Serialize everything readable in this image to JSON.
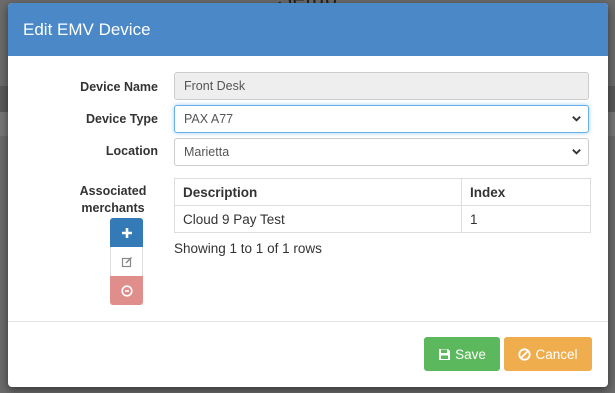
{
  "backdrop": {
    "title": "Setub"
  },
  "modal": {
    "title": "Edit EMV Device",
    "fields": {
      "device_name": {
        "label": "Device Name",
        "value": "Front Desk"
      },
      "device_type": {
        "label": "Device Type",
        "value": "PAX A77"
      },
      "location": {
        "label": "Location",
        "value": "Marietta"
      }
    },
    "associated_merchants": {
      "label": "Associated merchants",
      "columns": [
        "Description",
        "Index"
      ],
      "rows": [
        {
          "description": "Cloud 9 Pay Test",
          "index": "1"
        }
      ],
      "summary": "Showing 1 to 1 of 1 rows"
    },
    "footer": {
      "save_label": "Save",
      "cancel_label": "Cancel"
    }
  },
  "colors": {
    "header": "#4a88c8",
    "add_button": "#337ab7",
    "delete_button": "#e08e8b",
    "save_button": "#5cb85c",
    "cancel_button": "#f0ad4e"
  },
  "icons": {
    "add": "plus-icon",
    "edit": "edit-icon",
    "delete": "remove-circle-icon",
    "save": "floppy-disk-icon",
    "cancel": "ban-icon",
    "select": "chevron-down-icon"
  }
}
